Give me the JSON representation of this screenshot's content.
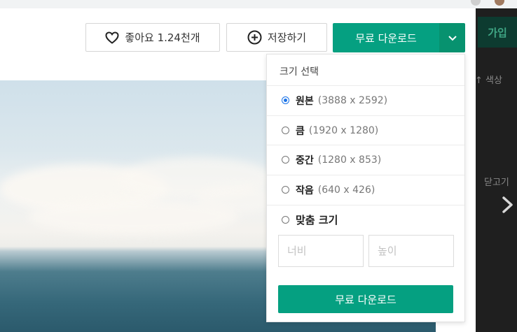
{
  "toolbar": {
    "like_label": "좋아요 1.24천개",
    "save_label": "저장하기",
    "download_label": "무료 다운로드"
  },
  "side": {
    "join_label": "가입",
    "color_label": "색상",
    "close_label": "닫고기"
  },
  "download_menu": {
    "title": "크기 선택",
    "options": [
      {
        "name": "원본",
        "dims": "(3888 x 2592)",
        "selected": true
      },
      {
        "name": "큼",
        "dims": "(1920 x 1280)",
        "selected": false
      },
      {
        "name": "중간",
        "dims": "(1280 x 853)",
        "selected": false
      },
      {
        "name": "작음",
        "dims": "(640 x 426)",
        "selected": false
      }
    ],
    "custom_label": "맞춤 크기",
    "width_placeholder": "너비",
    "height_placeholder": "높이",
    "download_label": "무료 다운로드"
  },
  "colors": {
    "accent": "#05a081",
    "radio_selected": "#1a73e8"
  },
  "icons": [
    "heart-icon",
    "plus-circle-icon",
    "chevron-down-icon",
    "chevron-right-icon"
  ]
}
